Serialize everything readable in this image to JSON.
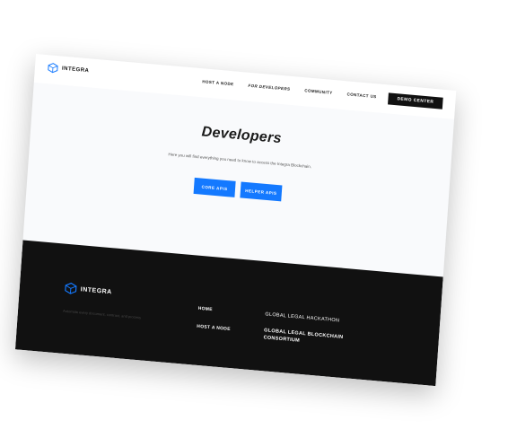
{
  "brand": {
    "name": "INTEGRA"
  },
  "nav": {
    "items": [
      "HOST A NODE",
      "FOR DEVELOPERS",
      "COMMUNITY",
      "CONTACT US"
    ],
    "cta": "DEMO CENTER"
  },
  "hero": {
    "title": "Developers",
    "subtitle": "Here you will find everything you need to know to access the Integra Blockchain.",
    "buttons": [
      "CORE APIS",
      "HELPER APIS"
    ]
  },
  "footer": {
    "brand": "INTEGRA",
    "tagline": "Automate every document, contract, and process",
    "col1": [
      "HOME",
      "HOST A NODE"
    ],
    "col2": [
      "GLOBAL LEGAL HACKATHON",
      "GLOBAL LEGAL BLOCKCHAIN CONSORTIUM"
    ]
  },
  "colors": {
    "accent": "#1479ff",
    "dark": "#111111"
  }
}
